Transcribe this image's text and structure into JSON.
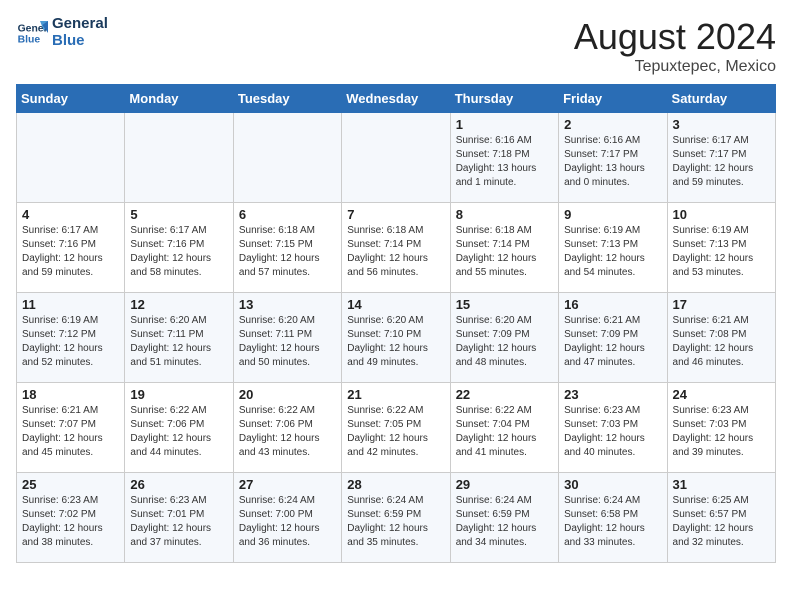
{
  "header": {
    "logo_line1": "General",
    "logo_line2": "Blue",
    "month": "August 2024",
    "location": "Tepuxtepec, Mexico"
  },
  "weekdays": [
    "Sunday",
    "Monday",
    "Tuesday",
    "Wednesday",
    "Thursday",
    "Friday",
    "Saturday"
  ],
  "weeks": [
    [
      {
        "day": "",
        "info": ""
      },
      {
        "day": "",
        "info": ""
      },
      {
        "day": "",
        "info": ""
      },
      {
        "day": "",
        "info": ""
      },
      {
        "day": "1",
        "info": "Sunrise: 6:16 AM\nSunset: 7:18 PM\nDaylight: 13 hours\nand 1 minute."
      },
      {
        "day": "2",
        "info": "Sunrise: 6:16 AM\nSunset: 7:17 PM\nDaylight: 13 hours\nand 0 minutes."
      },
      {
        "day": "3",
        "info": "Sunrise: 6:17 AM\nSunset: 7:17 PM\nDaylight: 12 hours\nand 59 minutes."
      }
    ],
    [
      {
        "day": "4",
        "info": "Sunrise: 6:17 AM\nSunset: 7:16 PM\nDaylight: 12 hours\nand 59 minutes."
      },
      {
        "day": "5",
        "info": "Sunrise: 6:17 AM\nSunset: 7:16 PM\nDaylight: 12 hours\nand 58 minutes."
      },
      {
        "day": "6",
        "info": "Sunrise: 6:18 AM\nSunset: 7:15 PM\nDaylight: 12 hours\nand 57 minutes."
      },
      {
        "day": "7",
        "info": "Sunrise: 6:18 AM\nSunset: 7:14 PM\nDaylight: 12 hours\nand 56 minutes."
      },
      {
        "day": "8",
        "info": "Sunrise: 6:18 AM\nSunset: 7:14 PM\nDaylight: 12 hours\nand 55 minutes."
      },
      {
        "day": "9",
        "info": "Sunrise: 6:19 AM\nSunset: 7:13 PM\nDaylight: 12 hours\nand 54 minutes."
      },
      {
        "day": "10",
        "info": "Sunrise: 6:19 AM\nSunset: 7:13 PM\nDaylight: 12 hours\nand 53 minutes."
      }
    ],
    [
      {
        "day": "11",
        "info": "Sunrise: 6:19 AM\nSunset: 7:12 PM\nDaylight: 12 hours\nand 52 minutes."
      },
      {
        "day": "12",
        "info": "Sunrise: 6:20 AM\nSunset: 7:11 PM\nDaylight: 12 hours\nand 51 minutes."
      },
      {
        "day": "13",
        "info": "Sunrise: 6:20 AM\nSunset: 7:11 PM\nDaylight: 12 hours\nand 50 minutes."
      },
      {
        "day": "14",
        "info": "Sunrise: 6:20 AM\nSunset: 7:10 PM\nDaylight: 12 hours\nand 49 minutes."
      },
      {
        "day": "15",
        "info": "Sunrise: 6:20 AM\nSunset: 7:09 PM\nDaylight: 12 hours\nand 48 minutes."
      },
      {
        "day": "16",
        "info": "Sunrise: 6:21 AM\nSunset: 7:09 PM\nDaylight: 12 hours\nand 47 minutes."
      },
      {
        "day": "17",
        "info": "Sunrise: 6:21 AM\nSunset: 7:08 PM\nDaylight: 12 hours\nand 46 minutes."
      }
    ],
    [
      {
        "day": "18",
        "info": "Sunrise: 6:21 AM\nSunset: 7:07 PM\nDaylight: 12 hours\nand 45 minutes."
      },
      {
        "day": "19",
        "info": "Sunrise: 6:22 AM\nSunset: 7:06 PM\nDaylight: 12 hours\nand 44 minutes."
      },
      {
        "day": "20",
        "info": "Sunrise: 6:22 AM\nSunset: 7:06 PM\nDaylight: 12 hours\nand 43 minutes."
      },
      {
        "day": "21",
        "info": "Sunrise: 6:22 AM\nSunset: 7:05 PM\nDaylight: 12 hours\nand 42 minutes."
      },
      {
        "day": "22",
        "info": "Sunrise: 6:22 AM\nSunset: 7:04 PM\nDaylight: 12 hours\nand 41 minutes."
      },
      {
        "day": "23",
        "info": "Sunrise: 6:23 AM\nSunset: 7:03 PM\nDaylight: 12 hours\nand 40 minutes."
      },
      {
        "day": "24",
        "info": "Sunrise: 6:23 AM\nSunset: 7:03 PM\nDaylight: 12 hours\nand 39 minutes."
      }
    ],
    [
      {
        "day": "25",
        "info": "Sunrise: 6:23 AM\nSunset: 7:02 PM\nDaylight: 12 hours\nand 38 minutes."
      },
      {
        "day": "26",
        "info": "Sunrise: 6:23 AM\nSunset: 7:01 PM\nDaylight: 12 hours\nand 37 minutes."
      },
      {
        "day": "27",
        "info": "Sunrise: 6:24 AM\nSunset: 7:00 PM\nDaylight: 12 hours\nand 36 minutes."
      },
      {
        "day": "28",
        "info": "Sunrise: 6:24 AM\nSunset: 6:59 PM\nDaylight: 12 hours\nand 35 minutes."
      },
      {
        "day": "29",
        "info": "Sunrise: 6:24 AM\nSunset: 6:59 PM\nDaylight: 12 hours\nand 34 minutes."
      },
      {
        "day": "30",
        "info": "Sunrise: 6:24 AM\nSunset: 6:58 PM\nDaylight: 12 hours\nand 33 minutes."
      },
      {
        "day": "31",
        "info": "Sunrise: 6:25 AM\nSunset: 6:57 PM\nDaylight: 12 hours\nand 32 minutes."
      }
    ]
  ]
}
